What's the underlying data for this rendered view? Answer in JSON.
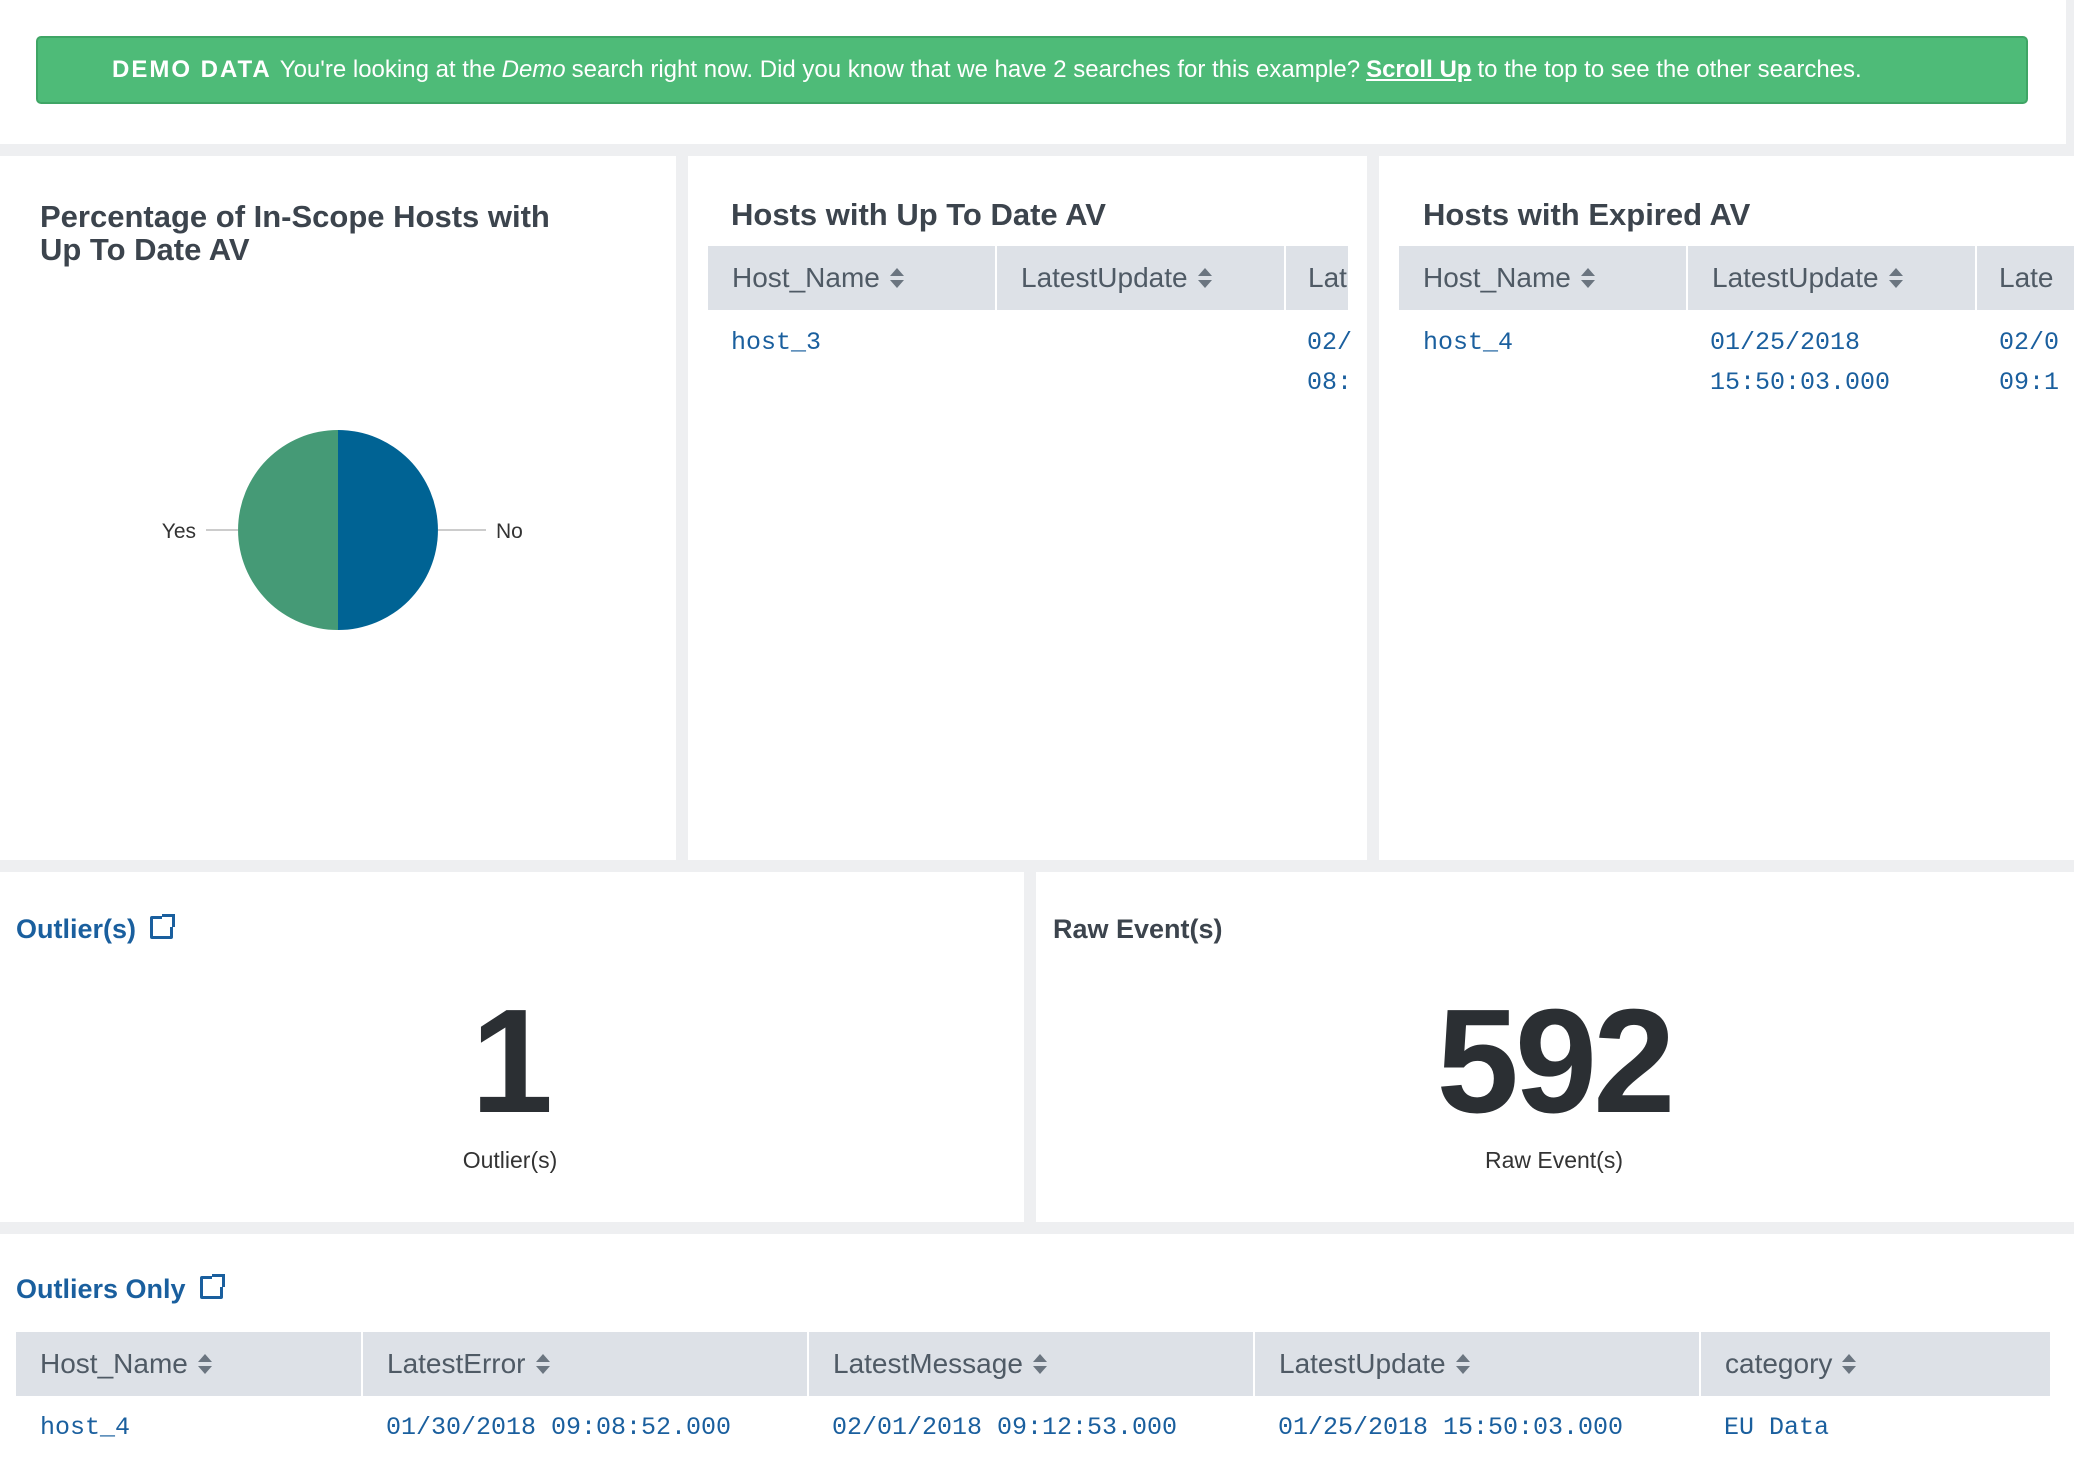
{
  "banner": {
    "tag": "DEMO DATA",
    "text_before": "You're looking at the",
    "emphasis": "Demo",
    "text_middle": "search right now. Did you know that we have 2 searches for this example?",
    "link": "Scroll Up",
    "text_after": "to the top to see the other searches.",
    "color": "#4ebb78"
  },
  "pie_panel": {
    "title_line1": "Percentage of In-Scope Hosts with",
    "title_line2": "Up To Date AV"
  },
  "chart_data": {
    "type": "pie",
    "title": "Percentage of In-Scope Hosts with Up To Date AV",
    "slices": [
      {
        "label": "Yes",
        "value": 50,
        "color": "#459a76"
      },
      {
        "label": "No",
        "value": 50,
        "color": "#006394"
      }
    ]
  },
  "uptodate_panel": {
    "title": "Hosts with Up To Date AV",
    "columns": [
      "Host_Name",
      "LatestUpdate",
      "Late"
    ],
    "rows": [
      {
        "host": "host_3",
        "latest_update": "",
        "late_line1": "02/",
        "late_line2": "08:"
      }
    ]
  },
  "expired_panel": {
    "title": "Hosts with Expired AV",
    "columns": [
      "Host_Name",
      "LatestUpdate",
      "Late"
    ],
    "rows": [
      {
        "host": "host_4",
        "update_line1": "01/25/2018",
        "update_line2": "15:50:03.000",
        "late_line1": "02/0",
        "late_line2": "09:1"
      }
    ]
  },
  "outliers_single": {
    "title": "Outlier(s)",
    "value": "1",
    "label": "Outlier(s)"
  },
  "raw_events_single": {
    "title": "Raw Event(s)",
    "value": "592",
    "label": "Raw Event(s)"
  },
  "outliers_table": {
    "title": "Outliers Only",
    "columns": [
      "Host_Name",
      "LatestError",
      "LatestMessage",
      "LatestUpdate",
      "category"
    ],
    "rows": [
      {
        "host": "host_4",
        "latest_error": "01/30/2018 09:08:52.000",
        "latest_message": "02/01/2018 09:12:53.000",
        "latest_update": "01/25/2018 15:50:03.000",
        "category": "EU Data"
      }
    ]
  }
}
